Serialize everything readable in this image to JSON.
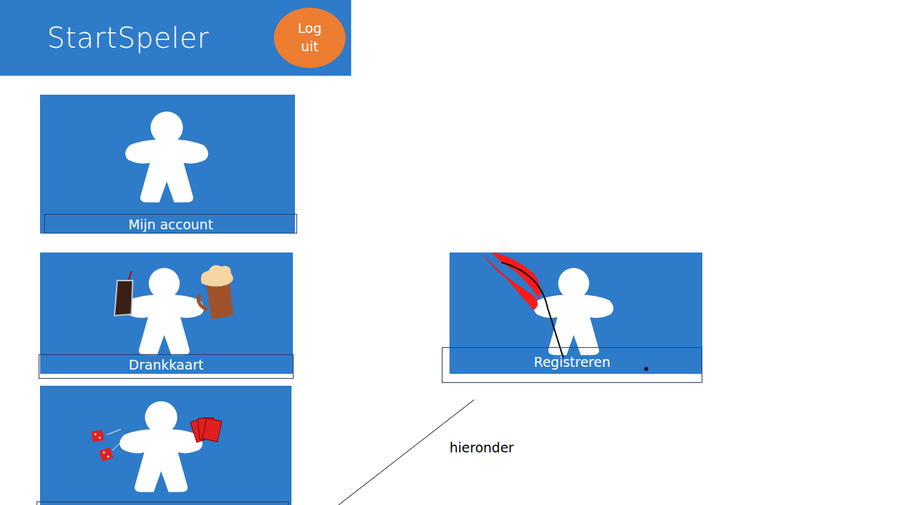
{
  "header": {
    "title": "StartSpeler",
    "logout": "Log uit"
  },
  "tiles": [
    {
      "kind": "account",
      "label": "Mijn account"
    },
    {
      "kind": "drinks",
      "label": "Drankkaart"
    },
    {
      "kind": "games"
    },
    {
      "kind": "register",
      "label": "Registreren"
    }
  ],
  "annotation": {
    "text": "hieronder"
  }
}
